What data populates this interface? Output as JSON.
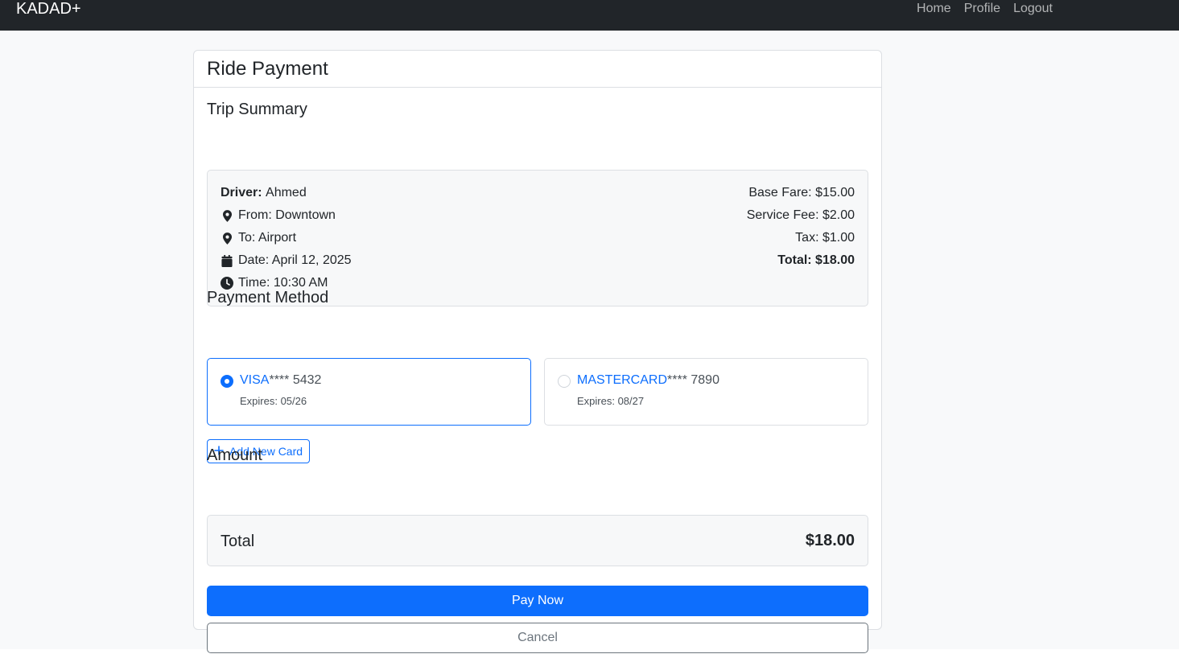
{
  "nav": {
    "brand": "KADAD+",
    "links": [
      "Home",
      "Profile",
      "Logout"
    ]
  },
  "card": {
    "title": "Ride Payment"
  },
  "trip_summary": {
    "title": "Trip Summary",
    "driver_label": "Driver:",
    "driver_name": "Ahmed",
    "from": "From: Downtown",
    "to": "To: Airport",
    "date": "Date: April 12, 2025",
    "time": "Time: 10:30 AM",
    "base_fare": "Base Fare: $15.00",
    "service_fee": "Service Fee: $2.00",
    "tax": "Tax: $1.00",
    "total": "Total: $18.00"
  },
  "payment_method": {
    "title": "Payment Method",
    "cards": [
      {
        "brand": "VISA",
        "masked": "**** 5432",
        "expires": "Expires: 05/26",
        "selected": true
      },
      {
        "brand": "MASTERCARD",
        "masked": "**** 7890",
        "expires": "Expires: 08/27",
        "selected": false
      }
    ],
    "add_card_label": "Add New Card"
  },
  "amount": {
    "title": "Amount",
    "label": "Total",
    "value": "$18.00"
  },
  "actions": {
    "pay_label": "Pay Now",
    "cancel_label": "Cancel"
  },
  "colors": {
    "primary": "#0d6efd",
    "navbar": "#212529",
    "page_bg": "#f8f9fa"
  }
}
